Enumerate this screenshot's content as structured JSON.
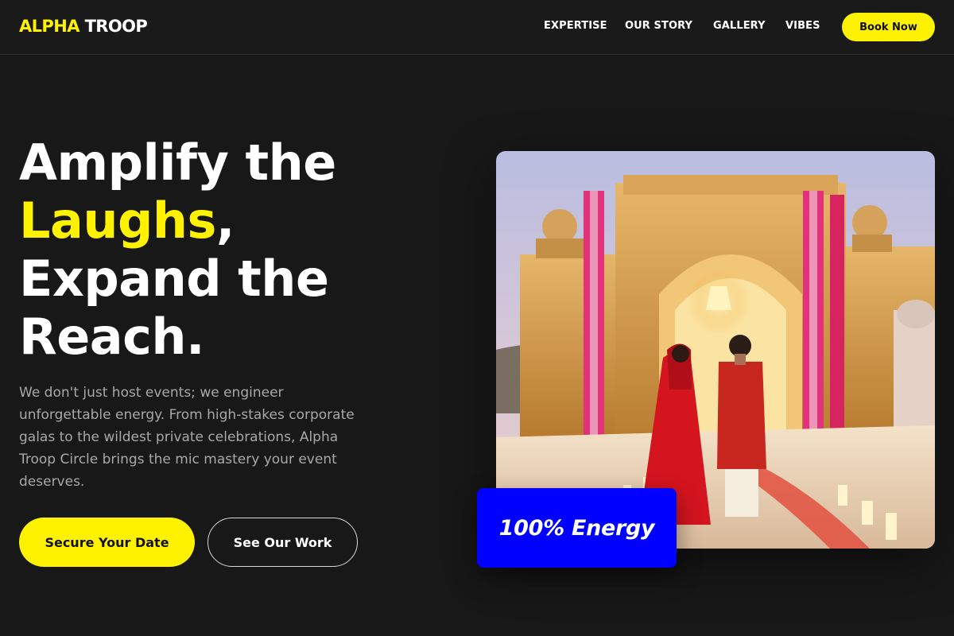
{
  "brand": {
    "logo_accent": "ALPHA",
    "logo_rest": "TROOP",
    "accent_color": "#fff200",
    "badge_color": "#0000ff"
  },
  "nav": {
    "links": [
      "EXPERTISE",
      "OUR STORY",
      "GALLERY",
      "VIBES"
    ],
    "cta_label": "Book Now"
  },
  "hero": {
    "headline_line1": "Amplify the",
    "headline_highlight": "Laughs",
    "headline_comma": ",",
    "headline_line3": "Expand the",
    "headline_line4": "Reach.",
    "description": "We don't just host events; we engineer unforgettable energy. From high-stakes corporate galas to the wildest private celebrations, Alpha Troop Circle brings the mic mastery your event deserves.",
    "primary_cta": "Secure Your Date",
    "secondary_cta": "See Our Work",
    "badge_text": "100% Energy"
  }
}
